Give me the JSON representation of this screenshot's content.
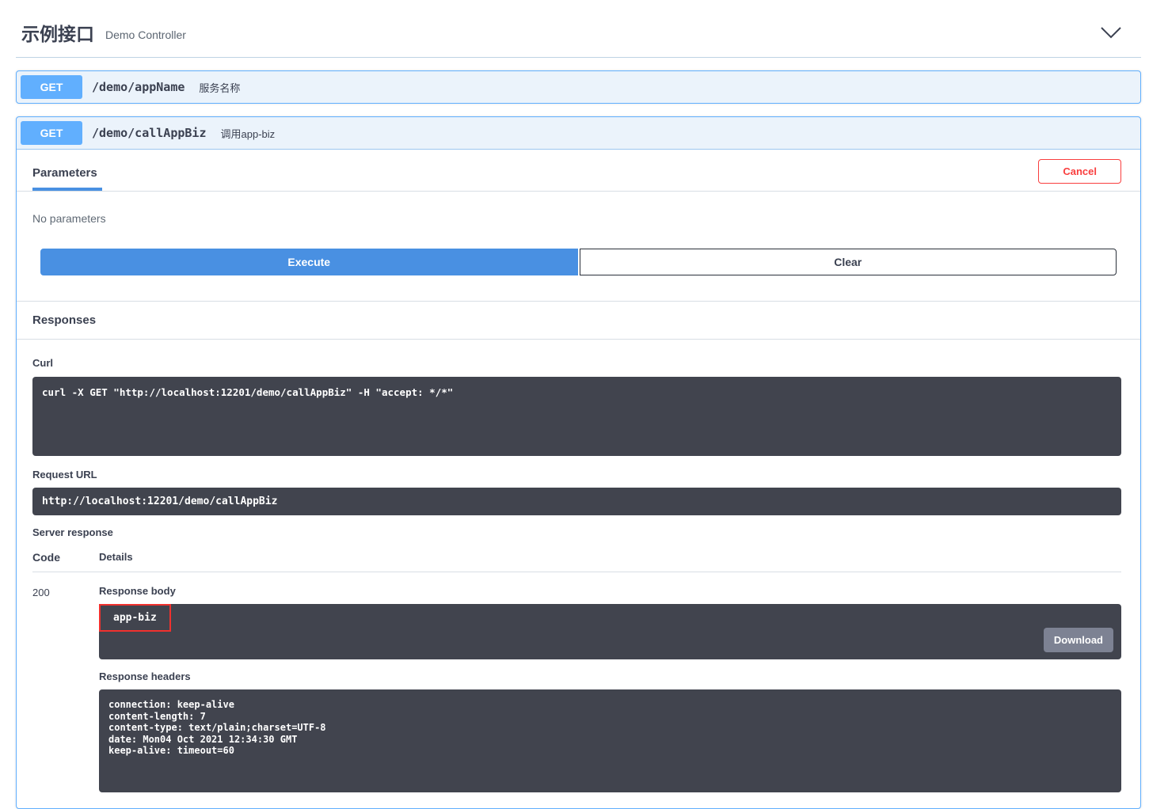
{
  "tag": {
    "title": "示例接口",
    "subtitle": "Demo Controller"
  },
  "endpoints": {
    "appName": {
      "method": "GET",
      "path": "/demo/appName",
      "description": "服务名称"
    },
    "callAppBiz": {
      "method": "GET",
      "path": "/demo/callAppBiz",
      "description": "调用app-biz"
    }
  },
  "operation": {
    "tabs": {
      "parameters": "Parameters"
    },
    "cancel_label": "Cancel",
    "no_parameters_text": "No parameters",
    "execute_label": "Execute",
    "clear_label": "Clear",
    "responses_title": "Responses",
    "curl": {
      "label": "Curl",
      "command": "curl -X GET \"http://localhost:12201/demo/callAppBiz\" -H \"accept: */*\""
    },
    "request_url": {
      "label": "Request URL",
      "value": "http://localhost:12201/demo/callAppBiz"
    },
    "server_response": {
      "label": "Server response",
      "code_header": "Code",
      "details_header": "Details",
      "code": "200",
      "response_body_label": "Response body",
      "response_body": "app-biz",
      "download_label": "Download",
      "response_headers_label": "Response headers",
      "response_headers": [
        "connection: keep-alive",
        "content-length: 7",
        "content-type: text/plain;charset=UTF-8",
        "date: Mon04 Oct 2021 12:34:30 GMT",
        "keep-alive: timeout=60"
      ]
    }
  },
  "colors": {
    "get_badge": "#61affe",
    "endpoint_border": "#61affe",
    "endpoint_bg": "#ebf3fb",
    "execute_button": "#4990e2",
    "code_block_bg": "#41444e",
    "cancel_red": "#f93e3e",
    "annotation_red": "#f0312e",
    "download_gray": "#7d8293"
  }
}
